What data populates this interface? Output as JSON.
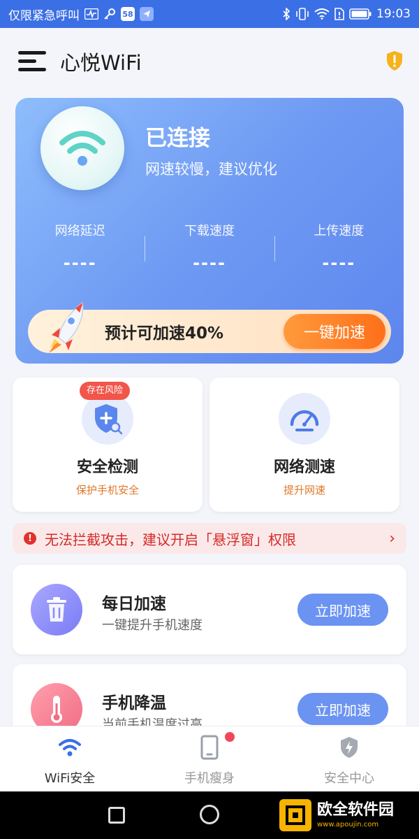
{
  "status_bar": {
    "carrier": "仅限紧急呼叫",
    "app_badge": "58",
    "time": "19:03"
  },
  "header": {
    "title": "心悦WiFi"
  },
  "hero": {
    "status": "已连接",
    "subtitle": "网速较慢，建议优化",
    "metrics": [
      {
        "label": "网络延迟",
        "value": "----"
      },
      {
        "label": "下载速度",
        "value": "----"
      },
      {
        "label": "上传速度",
        "value": "----"
      }
    ],
    "boost": {
      "text": "预计可加速40%",
      "button": "一键加速"
    }
  },
  "features": [
    {
      "title": "安全检测",
      "subtitle": "保护手机安全",
      "tag": "存在风险",
      "icon": "shield-plus-icon"
    },
    {
      "title": "网络测速",
      "subtitle": "提升网速",
      "icon": "speedometer-icon"
    }
  ],
  "warning": {
    "text": "无法拦截攻击，建议开启「悬浮窗」权限"
  },
  "list": [
    {
      "title": "每日加速",
      "subtitle": "一键提升手机速度",
      "button": "立即加速",
      "icon": "trash-icon"
    },
    {
      "title": "手机降温",
      "subtitle": "当前手机温度过高",
      "button": "立即加速",
      "icon": "thermometer-icon"
    }
  ],
  "tabs": [
    {
      "label": "WiFi安全",
      "icon": "wifi-icon",
      "active": true
    },
    {
      "label": "手机瘦身",
      "icon": "phone-icon",
      "active": false
    },
    {
      "label": "安全中心",
      "icon": "shield-bolt-icon",
      "active": false
    }
  ],
  "watermark": {
    "name": "欧全软件园",
    "url": "www.apoujin.com"
  },
  "colors": {
    "primary": "#3b6fe6",
    "accent_orange": "#ff6f1a",
    "warning_red": "#d52a26"
  }
}
